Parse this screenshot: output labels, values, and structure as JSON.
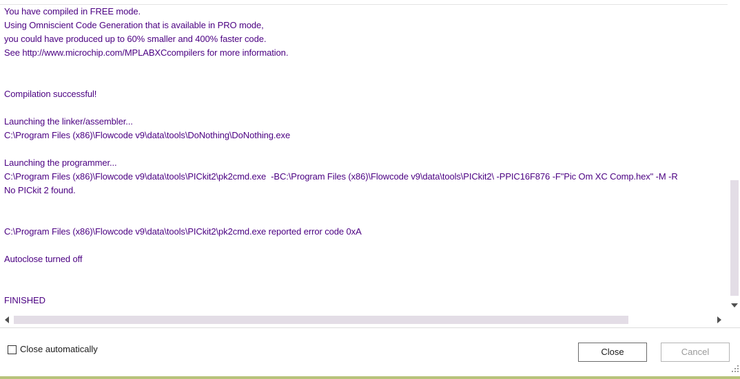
{
  "output": {
    "lines": [
      "You have compiled in FREE mode.",
      "Using Omniscient Code Generation that is available in PRO mode,",
      "you could have produced up to 60% smaller and 400% faster code.",
      "See http://www.microchip.com/MPLABXCcompilers for more information.",
      "",
      "",
      "Compilation successful!",
      "",
      "Launching the linker/assembler...",
      "C:\\Program Files (x86)\\Flowcode v9\\data\\tools\\DoNothing\\DoNothing.exe",
      "",
      "Launching the programmer...",
      "C:\\Program Files (x86)\\Flowcode v9\\data\\tools\\PICkit2\\pk2cmd.exe  -BC:\\Program Files (x86)\\Flowcode v9\\data\\tools\\PICkit2\\ -PPIC16F876 -F\"Pic Om XC Comp.hex\" -M -R",
      "No PICkit 2 found.",
      "",
      "",
      "C:\\Program Files (x86)\\Flowcode v9\\data\\tools\\PICkit2\\pk2cmd.exe reported error code 0xA",
      "",
      "Autoclose turned off",
      "",
      "",
      "FINISHED"
    ],
    "text_color": "#4b0082"
  },
  "footer": {
    "close_automatically_label": "Close automatically",
    "close_automatically_checked": false,
    "close_label": "Close",
    "cancel_label": "Cancel"
  },
  "icons": {
    "scroll_up": "chevron-up-icon",
    "scroll_down": "triangle-down-icon",
    "scroll_left": "triangle-left-icon",
    "scroll_right": "triangle-right-icon",
    "resize_grip": "resize-grip-icon"
  }
}
